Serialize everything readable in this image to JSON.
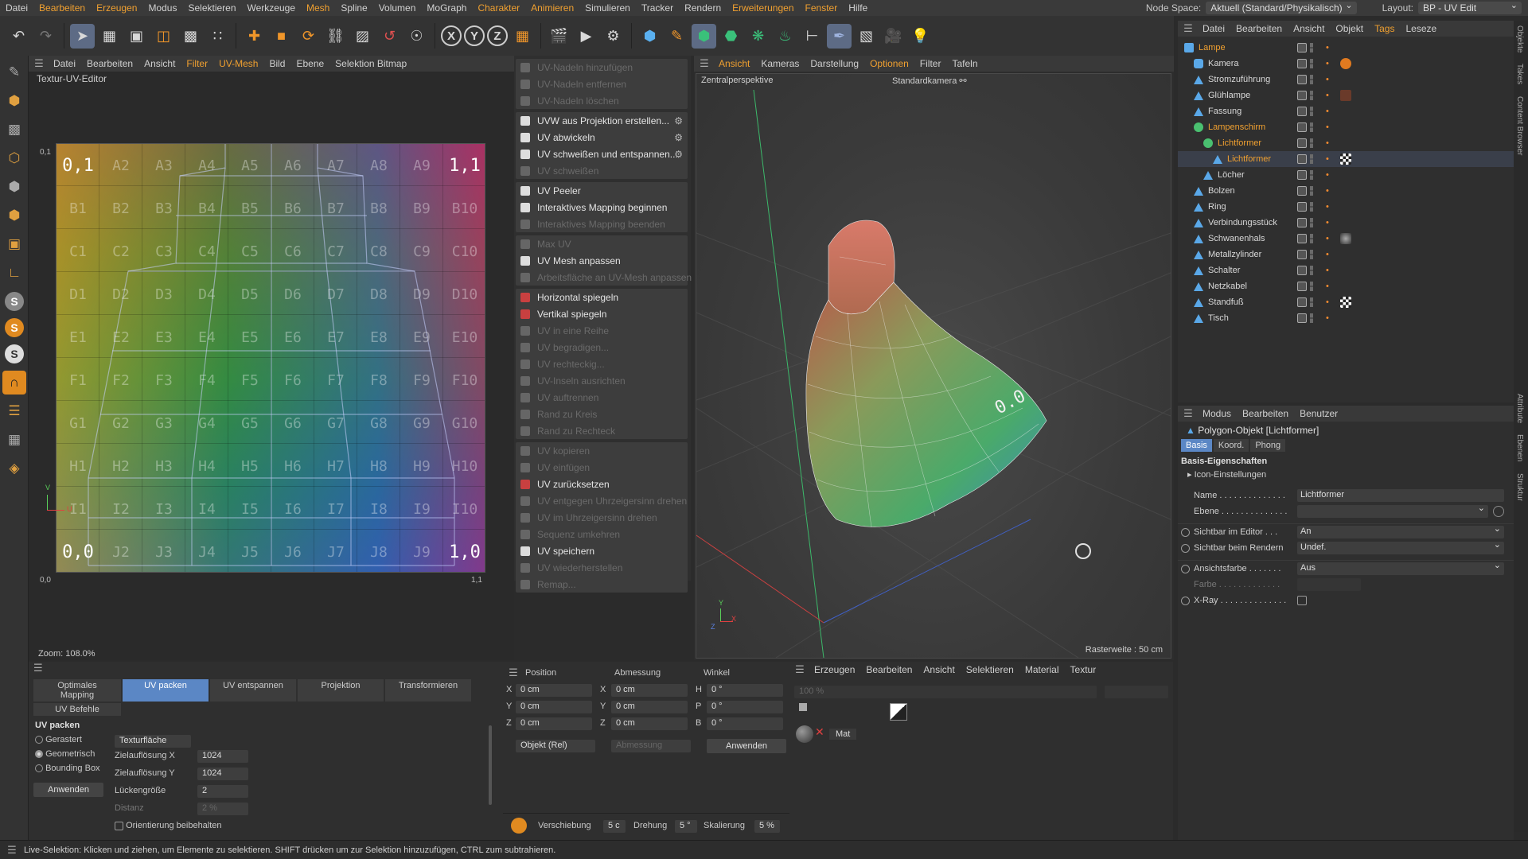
{
  "menubar": {
    "items": [
      "Datei",
      "Bearbeiten",
      "Erzeugen",
      "Modus",
      "Selektieren",
      "Werkzeuge",
      "Mesh",
      "Spline",
      "Volumen",
      "MoGraph",
      "Charakter",
      "Animieren",
      "Simulieren",
      "Tracker",
      "Rendern",
      "Erweiterungen",
      "Fenster",
      "Hilfe"
    ],
    "node_space_label": "Node Space:",
    "node_space_value": "Aktuell (Standard/Physikalisch)",
    "layout_label": "Layout:",
    "layout_value": "BP - UV Edit"
  },
  "uv_editor": {
    "menu": [
      "Datei",
      "Bearbeiten",
      "Ansicht",
      "Filter",
      "UV-Mesh",
      "Bild",
      "Ebene",
      "Selektion Bitmap"
    ],
    "title": "Textur-UV-Editor",
    "zoom": "Zoom: 108.0%",
    "corner_tl": "0,1",
    "corner_tr": "1,1",
    "corner_bl": "0,0",
    "corner_br": "1,0",
    "axis_v": "V",
    "axis_u": "U",
    "rows": [
      "A",
      "B",
      "C",
      "D",
      "E",
      "F",
      "G",
      "H",
      "I",
      "J"
    ],
    "row0": [
      "0,1",
      "A2",
      "A3",
      "A4",
      "A5",
      "A6",
      "A7",
      "A8",
      "A9",
      "1,1"
    ],
    "row9": [
      "0,0",
      "J2",
      "J3",
      "J4",
      "J5",
      "J6",
      "J7",
      "J8",
      "J9",
      "1,0"
    ]
  },
  "uv_commands": {
    "groups": [
      [
        {
          "label": "UV-Nadeln hinzufügen",
          "dis": true
        },
        {
          "label": "UV-Nadeln entfernen",
          "dis": true
        },
        {
          "label": "UV-Nadeln löschen",
          "dis": true
        }
      ],
      [
        {
          "label": "UVW aus Projektion erstellen...",
          "dis": false,
          "gear": true
        },
        {
          "label": "UV abwickeln",
          "dis": false,
          "gear": true
        },
        {
          "label": "UV schweißen und entspannen...",
          "dis": false,
          "gear": true
        },
        {
          "label": "UV schweißen",
          "dis": true
        }
      ],
      [
        {
          "label": "UV Peeler",
          "dis": false
        },
        {
          "label": "Interaktives Mapping beginnen",
          "dis": false
        },
        {
          "label": "Interaktives Mapping beenden",
          "dis": true
        }
      ],
      [
        {
          "label": "Max UV",
          "dis": true
        },
        {
          "label": "UV Mesh anpassen",
          "dis": false
        },
        {
          "label": "Arbeitsfläche an UV-Mesh anpassen",
          "dis": true
        }
      ],
      [
        {
          "label": "Horizontal spiegeln",
          "dis": false
        },
        {
          "label": "Vertikal spiegeln",
          "dis": false
        },
        {
          "label": "UV in eine Reihe",
          "dis": true
        },
        {
          "label": "UV begradigen...",
          "dis": true
        },
        {
          "label": "UV rechteckig...",
          "dis": true
        },
        {
          "label": "UV-Inseln ausrichten",
          "dis": true
        },
        {
          "label": "UV auftrennen",
          "dis": true
        },
        {
          "label": "Rand zu Kreis",
          "dis": true
        },
        {
          "label": "Rand zu Rechteck",
          "dis": true
        }
      ],
      [
        {
          "label": "UV kopieren",
          "dis": true
        },
        {
          "label": "UV einfügen",
          "dis": true
        },
        {
          "label": "UV zurücksetzen",
          "dis": false
        },
        {
          "label": "UV entgegen Uhrzeigersinn drehen",
          "dis": true
        },
        {
          "label": "UV im Uhrzeigersinn drehen",
          "dis": true
        },
        {
          "label": "Sequenz umkehren",
          "dis": true
        },
        {
          "label": "UV speichern",
          "dis": false
        },
        {
          "label": "UV wiederherstellen",
          "dis": true
        },
        {
          "label": "Remap...",
          "dis": true
        }
      ]
    ]
  },
  "viewport": {
    "menu": [
      "Ansicht",
      "Kameras",
      "Darstellung",
      "Optionen",
      "Filter",
      "Tafeln"
    ],
    "camera": "Zentralperspektive",
    "std_camera": "Standardkamera",
    "grid": "Rasterweite : 50 cm",
    "axis_x": "X",
    "axis_y": "Y",
    "axis_z": "Z"
  },
  "object_manager": {
    "menu": [
      "Datei",
      "Bearbeiten",
      "Ansicht",
      "Objekt",
      "Tags",
      "Leseze"
    ],
    "objects": [
      {
        "name": "Lampe",
        "indent": 0,
        "orange": true,
        "icon": "lamp",
        "sel": false
      },
      {
        "name": "Kamera",
        "indent": 1,
        "orange": false,
        "icon": "cam",
        "sel": false
      },
      {
        "name": "Stromzuführung",
        "indent": 1,
        "orange": false,
        "icon": "tri",
        "sel": false
      },
      {
        "name": "Glühlampe",
        "indent": 1,
        "orange": false,
        "icon": "tri",
        "sel": false
      },
      {
        "name": "Fassung",
        "indent": 1,
        "orange": false,
        "icon": "tri",
        "sel": false
      },
      {
        "name": "Lampenschirm",
        "indent": 1,
        "orange": true,
        "icon": "grp",
        "sel": false
      },
      {
        "name": "Lichtformer",
        "indent": 2,
        "orange": true,
        "icon": "grp",
        "sel": false
      },
      {
        "name": "Lichtformer",
        "indent": 3,
        "orange": true,
        "icon": "tri",
        "sel": true
      },
      {
        "name": "Löcher",
        "indent": 2,
        "orange": false,
        "icon": "tri",
        "sel": false
      },
      {
        "name": "Bolzen",
        "indent": 1,
        "orange": false,
        "icon": "tri",
        "sel": false
      },
      {
        "name": "Ring",
        "indent": 1,
        "orange": false,
        "icon": "tri",
        "sel": false
      },
      {
        "name": "Verbindungsstück",
        "indent": 1,
        "orange": false,
        "icon": "tri",
        "sel": false
      },
      {
        "name": "Schwanenhals",
        "indent": 1,
        "orange": false,
        "icon": "tri",
        "sel": false
      },
      {
        "name": "Metallzylinder",
        "indent": 1,
        "orange": false,
        "icon": "tri",
        "sel": false
      },
      {
        "name": "Schalter",
        "indent": 1,
        "orange": false,
        "icon": "tri",
        "sel": false
      },
      {
        "name": "Netzkabel",
        "indent": 1,
        "orange": false,
        "icon": "tri",
        "sel": false
      },
      {
        "name": "Standfuß",
        "indent": 1,
        "orange": false,
        "icon": "tri",
        "sel": false
      },
      {
        "name": "Tisch",
        "indent": 1,
        "orange": false,
        "icon": "tri",
        "sel": false
      }
    ]
  },
  "attribute_manager": {
    "menu": [
      "Modus",
      "Bearbeiten",
      "Benutzer"
    ],
    "title": "Polygon-Objekt [Lichtformer]",
    "tabs": [
      "Basis",
      "Koord.",
      "Phong"
    ],
    "section": "Basis-Eigenschaften",
    "icon_settings": "Icon-Einstellungen",
    "name_label": "Name . . . . . . . . . . . . . .",
    "name_value": "Lichtformer",
    "layer_label": "Ebene . . . . . . . . . . . . . .",
    "vis_editor_label": "Sichtbar im Editor . . .",
    "vis_editor_value": "An",
    "vis_render_label": "Sichtbar beim Rendern",
    "vis_render_value": "Undef.",
    "viewcolor_label": "Ansichtsfarbe . . . . . . .",
    "viewcolor_value": "Aus",
    "color_label": "Farbe . . . . . . . . . . . . .",
    "xray_label": "X-Ray . . . . . . . . . . . . . ."
  },
  "side_tabs": [
    "Objekte",
    "Takes",
    "Content Browser",
    "Attribute",
    "Ebenen",
    "Struktur"
  ],
  "uv_pack": {
    "tabs_row1": [
      "Optimales Mapping",
      "UV packen",
      "UV entspannen",
      "Projektion",
      "Transformieren"
    ],
    "tabs_row2": [
      "UV Befehle"
    ],
    "section": "UV packen",
    "mode_rast": "Gerastert",
    "mode_geo": "Geometrisch",
    "mode_bbox": "Bounding Box",
    "apply": "Anwenden",
    "texturflache": "Texturfläche",
    "res_x_label": "Zielauflösung X",
    "res_x": "1024",
    "res_y_label": "Zielauflösung Y",
    "res_y": "1024",
    "gap_label": "Lückengröße",
    "gap": "2",
    "dist_label": "Distanz",
    "dist": "2 %",
    "keep_orient": "Orientierung beibehalten"
  },
  "coords": {
    "headers": [
      "Position",
      "Abmessung",
      "Winkel"
    ],
    "rows": [
      {
        "a": "X",
        "pos": "0 cm",
        "b": "X",
        "size": "0 cm",
        "c": "H",
        "ang": "0 °"
      },
      {
        "a": "Y",
        "pos": "0 cm",
        "b": "Y",
        "size": "0 cm",
        "c": "P",
        "ang": "0 °"
      },
      {
        "a": "Z",
        "pos": "0 cm",
        "b": "Z",
        "size": "0 cm",
        "c": "B",
        "ang": "0 °"
      }
    ],
    "mode": "Objekt (Rel)",
    "size_mode": "Abmessung",
    "apply": "Anwenden",
    "shift_label": "Verschiebung",
    "shift": "5 c",
    "rot_label": "Drehung",
    "rot": "5 °",
    "scale_label": "Skalierung",
    "scale": "5 %"
  },
  "material_manager": {
    "menu": [
      "Erzeugen",
      "Bearbeiten",
      "Ansicht",
      "Selektieren",
      "Material",
      "Textur"
    ],
    "zoom": "100 %",
    "material": "Mat"
  },
  "status": "Live-Selektion: Klicken und ziehen, um Elemente zu selektieren. SHIFT drücken um zur Selektion hinzuzufügen, CTRL zum subtrahieren."
}
